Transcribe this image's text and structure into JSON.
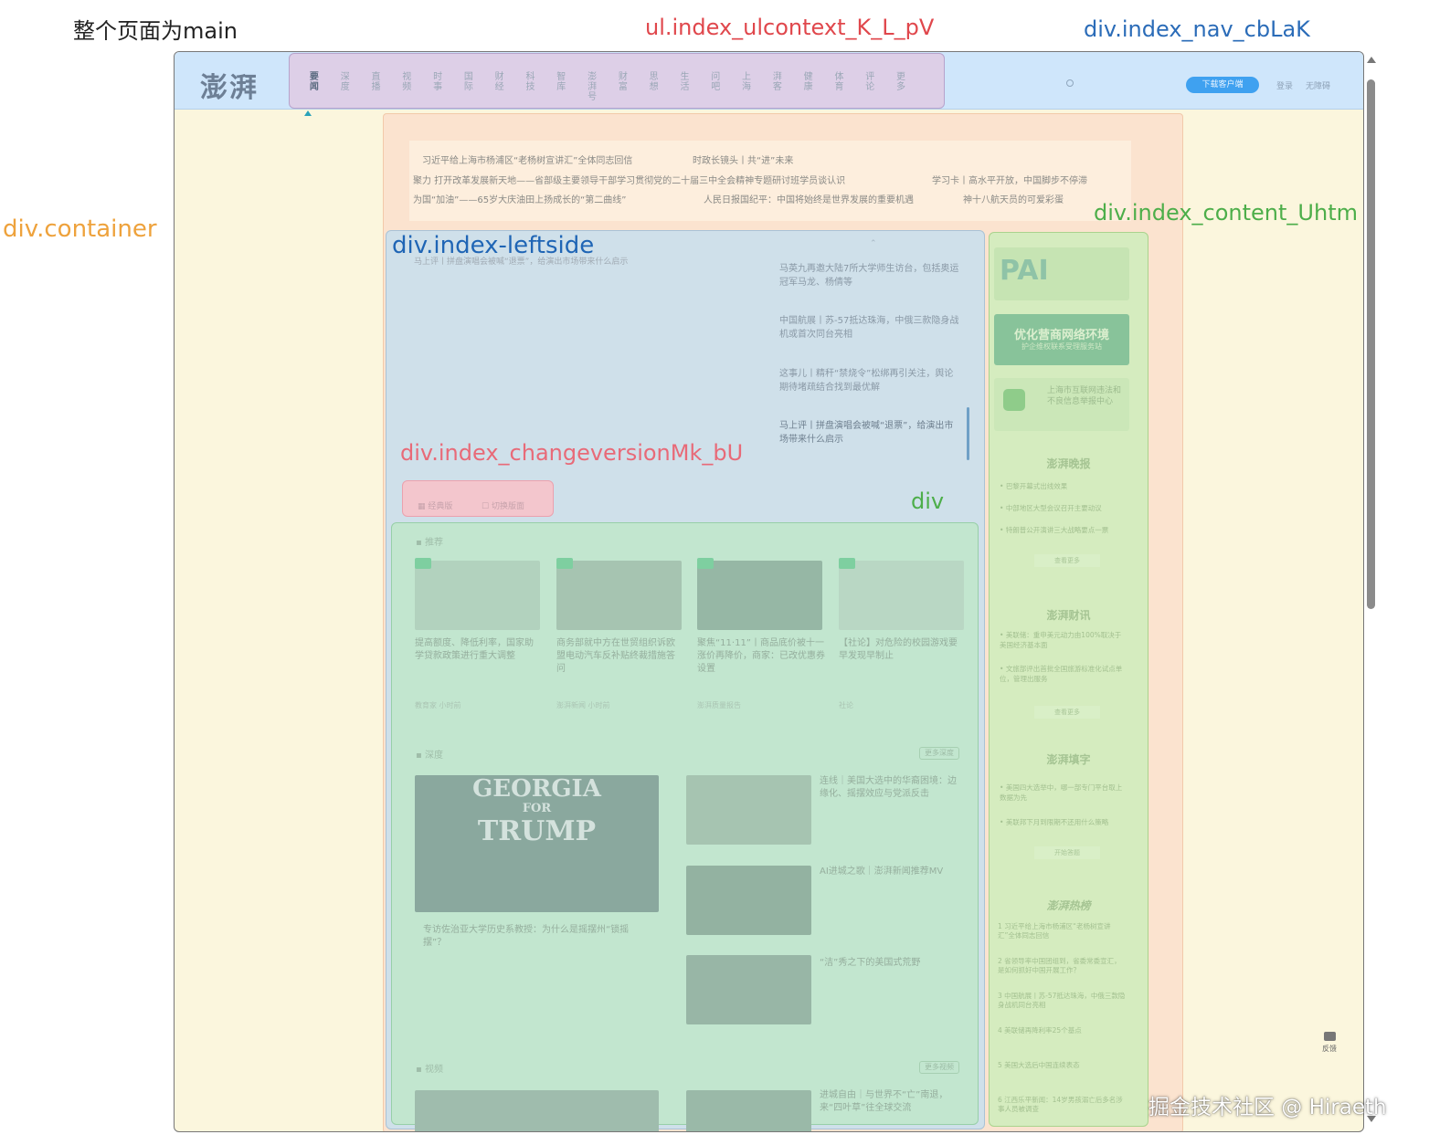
{
  "annotations": {
    "main": "整个页面为main",
    "ulcontext": "ul.index_ulcontext_K_L_pV",
    "nav": "div.index_nav_cbLaK",
    "div1": "div",
    "container": "div.container",
    "content": "div.index_content_Uhtm",
    "leftside": "div.index-leftside",
    "changeversion": "div.index_changeversionMk_bU",
    "div2": "div"
  },
  "colors": {
    "main_label": "#222222",
    "ulcontext_label": "#e0474c",
    "nav_label": "#2b6cb8",
    "div_label": "#d8383e",
    "container_label": "#eea23c",
    "content_label": "#4dae4a",
    "leftside_label": "#1f65b5",
    "changeversion_label": "#e86a78",
    "div2_label": "#4dae4a"
  },
  "nav": {
    "logo": "澎湃",
    "items": [
      "要闻",
      "深度",
      "直播",
      "视频",
      "时事",
      "国际",
      "财经",
      "科技",
      "智库",
      "澎湃号",
      "财富",
      "思想",
      "生活",
      "问吧",
      "上海",
      "湃客",
      "健康",
      "体育",
      "评论",
      "更多"
    ],
    "download_button": "下载客户端",
    "login": "登录",
    "barrier_free": "无障碍"
  },
  "ticker": {
    "row1": [
      "习近平给上海市杨浦区“老杨树宣讲汇”全体同志回信",
      "时政长镜头丨共“进”未来"
    ],
    "row2": [
      "聚力 打开改革发展新天地——省部级主要领导干部学习贯彻党的二十届三中全会精神专题研讨班学员谈认识",
      "学习卡丨高水平开放，中国脚步不停滞"
    ],
    "row3": [
      "为国“加油”——65岁大庆油田上扬成长的“第二曲线”",
      "人民日报国纪平：中国将始终是世界发展的重要机遇",
      "神十八航天员的可爱彩蛋"
    ]
  },
  "hero": {
    "image_caption": "马上评丨拼盘演唱会被喊“退票”，给演出市场带来什么启示",
    "items": [
      "马英九再邀大陆7所大学师生访台，包括奥运冠军马龙、杨倩等",
      "中国航展丨苏-57抵达珠海，中俄三款隐身战机或首次同台亮相",
      "这事儿丨精秆“禁烧令”松绑再引关注，舆论期待堵疏结合找到最优解",
      "马上评丨拼盘演唱会被喊“退票”，给演出市场带来什么启示"
    ]
  },
  "changeversion": {
    "btn1": "经典版",
    "btn2": "切换版面"
  },
  "recommend": {
    "title": "推荐",
    "cards": [
      {
        "title": "提高额度、降低利率，国家助学贷款政策进行重大调整",
        "meta": "教育家  小时前"
      },
      {
        "title": "商务部就中方在世贸组织诉欧盟电动汽车反补贴终裁措施答问",
        "meta": "澎湃新闻  小时前"
      },
      {
        "title": "聚焦“11·11”丨商品底价被十一涨价再降价，商家：已改优惠券设置",
        "meta": "澎湃质量报告"
      },
      {
        "title": "【社论】对危险的校园游戏要早发现早制止",
        "meta": "社论"
      }
    ]
  },
  "depth": {
    "title": "深度",
    "more": "更多深度",
    "main_title": "专访佐治亚大学历史系教授：为什么是摇摆州“锁摇摆”？",
    "image_line1": "GEORGIA",
    "image_line2": "FOR",
    "image_line3": "TRUMP",
    "side": [
      "连线｜美国大选中的华裔困境：边缘化、摇摆效应与党派反击",
      "AI进城之歌｜澎湃新闻推荐MV",
      "“洁”秀之下的美国式荒野"
    ]
  },
  "video": {
    "title": "视频",
    "more": "更多视频",
    "side": "进城自由｜与世界不“亡”南退，来“四叶草”往全球交流"
  },
  "rightcol": {
    "ad_title": "优化营商网络环境",
    "ad_sub": "护企维权联系受理服务站",
    "report_title": "上海市互联网违法和不良信息举报中心",
    "evening_title": "澎湃晚报",
    "evening_items": [
      "巴黎开幕式出线效果",
      "中部地区大型会议召开主要动议",
      "特朗普公开演讲三大战略要点一票"
    ],
    "evening_more": "查看更多",
    "finance_title": "澎湃财讯",
    "finance_items": [
      "美联储：重申美元动力由100%取决于美国经济基本面",
      "文旅部评出首批全国旅游标准化试点单位，管理出服务"
    ],
    "finance_more": "查看更多",
    "fill_title": "澎湃填字",
    "fill_items": [
      "美国四大选举中，哪一部专门平台取上数据为先",
      "美联邦下月到限期不还用什么策略"
    ],
    "fill_more": "开始答题",
    "hot_title": "澎湃热榜",
    "hot_items": [
      "习近平给上海市杨浦区“老杨树宣讲汇”全体同志回信",
      "省领导率中国团组到，省委常委宣汇，是如何抓好中国开展工作？",
      "中国航展丨苏-57抵达珠海，中俄三款隐身战机同台亮相",
      "美联储再降利率25个基点",
      "美国大选后中国连续表态",
      "江西乐平新闻：14岁男孩溺亡后多名涉事人员被调查"
    ]
  },
  "feedback": "反馈",
  "watermark": "掘金技术社区 @ Hiraeth"
}
